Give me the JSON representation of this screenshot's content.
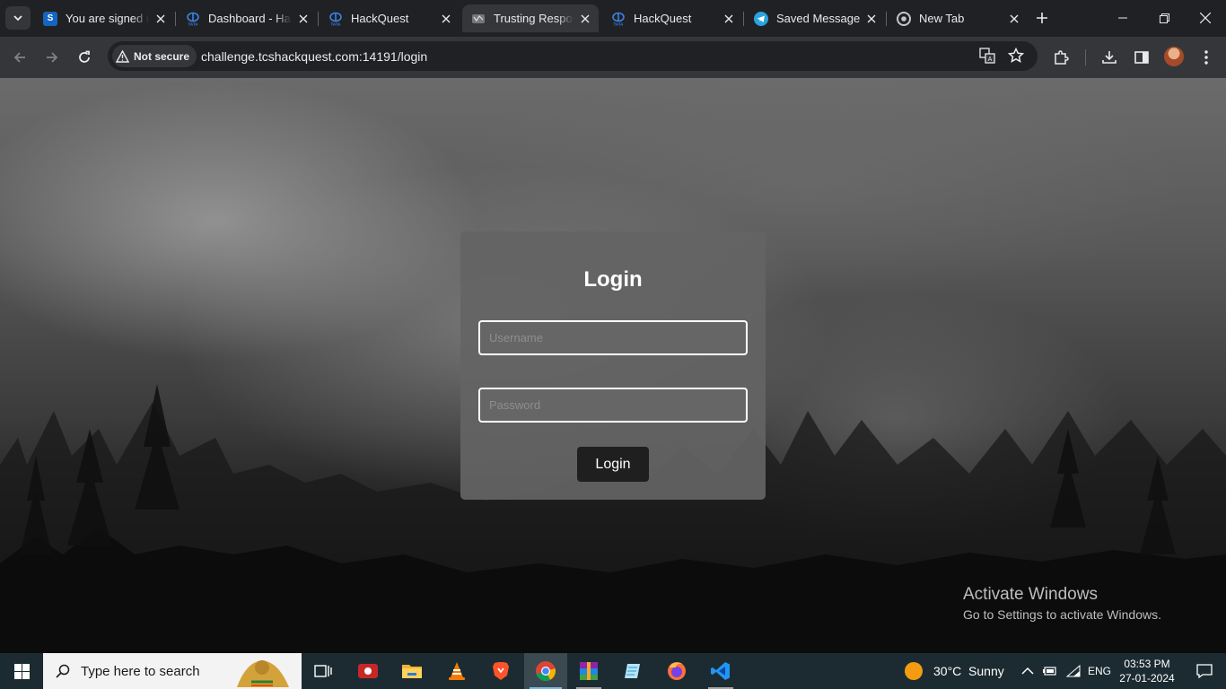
{
  "browser": {
    "tabs": [
      {
        "title": "You are signed in",
        "favicon": "S",
        "favicon_color": "#1565c0"
      },
      {
        "title": "Dashboard - HackQuest",
        "favicon": "TATA",
        "favicon_color": "#1e6fd9"
      },
      {
        "title": "HackQuest",
        "favicon": "TATA",
        "favicon_color": "#1e6fd9"
      },
      {
        "title": "Trusting Responses",
        "favicon": "web",
        "favicon_color": "#888888"
      },
      {
        "title": "HackQuest",
        "favicon": "TATA",
        "favicon_color": "#1e6fd9"
      },
      {
        "title": "Saved Messages",
        "favicon": "telegram",
        "favicon_color": "#2aa3e0"
      },
      {
        "title": "New Tab",
        "favicon": "chrome",
        "favicon_color": "#9aa0a6"
      }
    ],
    "active_tab_index": 3,
    "security_chip": "Not secure",
    "url_host": "challenge.tcshackquest.com",
    "url_rest": ":14191/login"
  },
  "page": {
    "title": "Login",
    "username_placeholder": "Username",
    "password_placeholder": "Password",
    "login_button": "Login"
  },
  "watermark": {
    "line1": "Activate Windows",
    "line2": "Go to Settings to activate Windows."
  },
  "taskbar": {
    "search_placeholder": "Type here to search",
    "weather": "30°C  Sunny",
    "language": "ENG",
    "time": "03:53 PM",
    "date": "27-01-2024"
  }
}
